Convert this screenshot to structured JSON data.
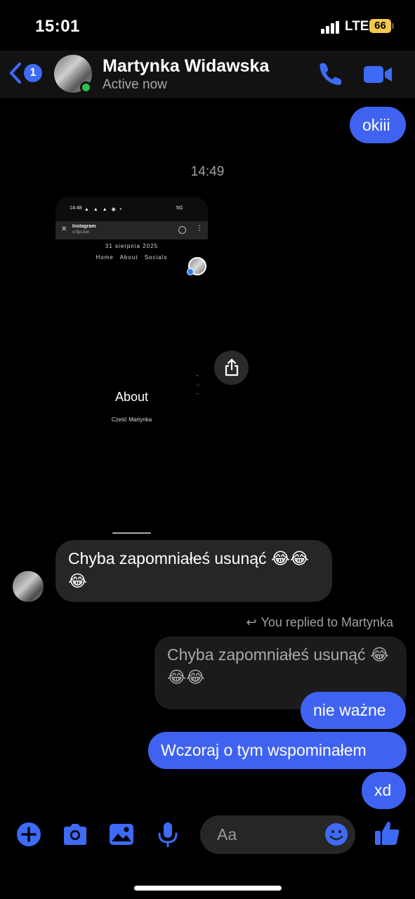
{
  "status_bar": {
    "time": "15:01",
    "network": "LTE",
    "battery": "66"
  },
  "header": {
    "back_badge": "1",
    "contact_name": "Martynka Widawska",
    "presence": "Active now",
    "icons": [
      "back-chevron-icon",
      "phone-icon",
      "video-camera-icon"
    ]
  },
  "messages": {
    "okiii": "okiii",
    "timestamp": "14:49",
    "shared_image": {
      "status_time": "14:48",
      "network": "5G",
      "url_title": "Instagram",
      "url": "o fips.fun",
      "date": "31 sierpnia 2025",
      "nav": "Home About Socials",
      "about_title": "About",
      "about_text": "Cześć Martynka"
    },
    "incoming": "Chyba zapomniałeś usunąć 😂😂😂",
    "replied_label": "You replied to Martynka",
    "quoted": "Chyba zapomniałeś usunąć 😂😂😂",
    "outgoing_1": "nie ważne",
    "outgoing_2": "Wczoraj o tym wspominałem",
    "outgoing_3": "xd"
  },
  "composer": {
    "placeholder": "Aa",
    "icons": [
      "plus-icon",
      "camera-icon",
      "image-icon",
      "microphone-icon",
      "emoji-icon",
      "thumbs-up-icon"
    ]
  },
  "colors": {
    "accent": "#3f63f0",
    "incoming_bubble": "#262626",
    "online": "#2ec24d"
  }
}
